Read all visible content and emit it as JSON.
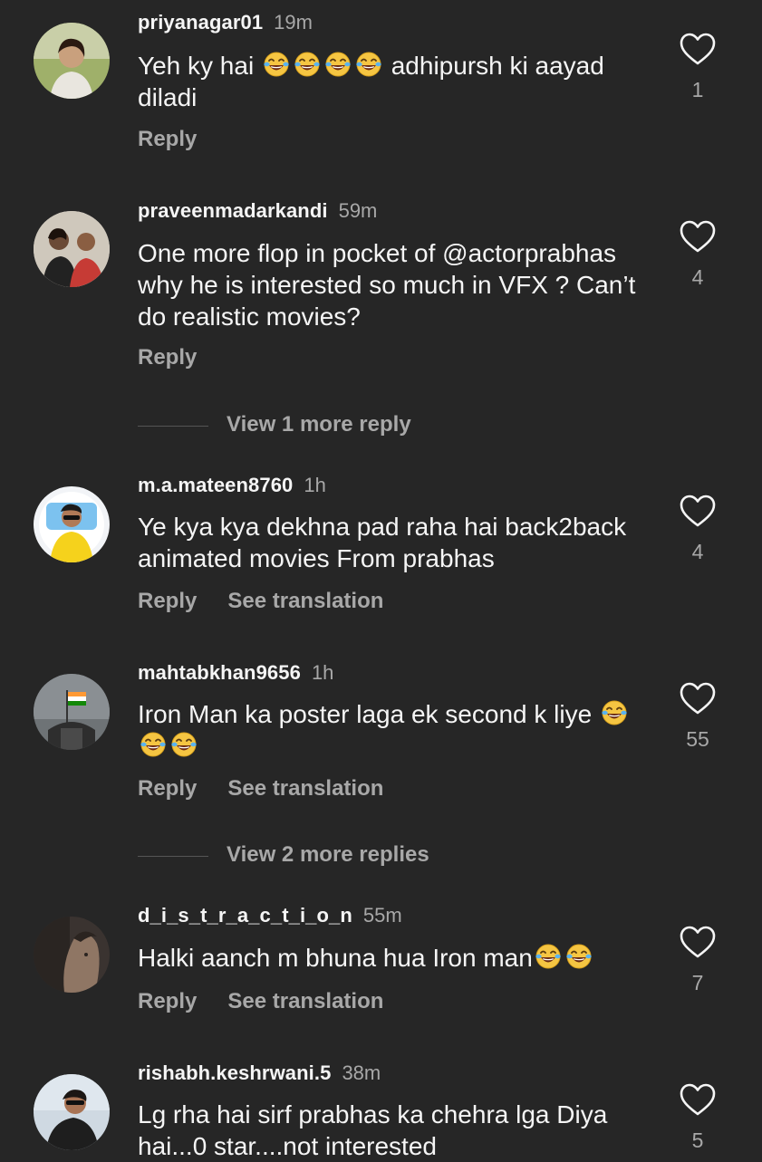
{
  "comments": [
    {
      "username": "priyanagar01",
      "time": "19m",
      "text_before": "Yeh ky hai ",
      "emoji_count_inline": 4,
      "text_after": " adhipursh ki aayad diladi",
      "reply_label": "Reply",
      "likes": "1"
    },
    {
      "username": "praveenmadarkandi",
      "time": "59m",
      "text": "One more flop in pocket of @actorprabhas why he is interested so much in VFX ? Can’t do realistic movies?",
      "reply_label": "Reply",
      "likes": "4",
      "view_more": "View 1 more reply"
    },
    {
      "username": "m.a.mateen8760",
      "time": "1h",
      "text": "Ye kya kya dekhna pad raha hai back2back animated movies From prabhas",
      "reply_label": "Reply",
      "translate_label": "See translation",
      "likes": "4"
    },
    {
      "username": "mahtabkhan9656",
      "time": "1h",
      "text": "Iron Man ka poster laga ek second k liye",
      "reply_label": "Reply",
      "translate_label": "See translation",
      "likes": "55",
      "view_more": "View 2 more replies"
    },
    {
      "username": "d_i_s_t_r_a_c_t_i_o_n",
      "time": "55m",
      "text": "Halki aanch m bhuna hua Iron man",
      "reply_label": "Reply",
      "translate_label": "See translation",
      "likes": "7"
    },
    {
      "username": "rishabh.keshrwani.5",
      "time": "38m",
      "text": "Lg rha hai sirf prabhas ka chehra lga Diya hai...0 star....not interested",
      "likes": "5"
    }
  ],
  "colors": {
    "background": "#262626",
    "primary_text": "#f5f5f5",
    "secondary_text": "#a8a8a8"
  },
  "icons": {
    "like": "heart-outline-icon",
    "emoji": "face-with-tears-of-joy-icon"
  }
}
